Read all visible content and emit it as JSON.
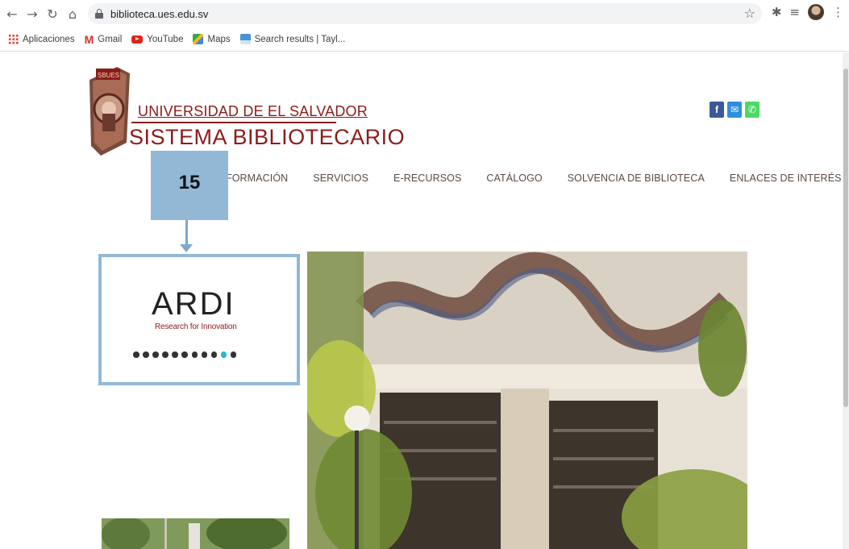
{
  "browser": {
    "url": "biblioteca.ues.edu.sv",
    "bookmarks": [
      "Aplicaciones",
      "Gmail",
      "YouTube",
      "Maps",
      "Search results | Tayl..."
    ]
  },
  "header": {
    "university": "UNIVERSIDAD DE EL SALVADOR",
    "system": "SISTEMA BIBLIOTECARIO",
    "logo_text": "SBUES",
    "social": {
      "facebook": "f",
      "mail": "✉",
      "phone": "✆"
    }
  },
  "menu": {
    "items": [
      "FORMACIÓN",
      "SERVICIOS",
      "E-RECURSOS",
      "CATÁLOGO",
      "SOLVENCIA DE BIBLIOTECA",
      "ENLACES DE INTERÉS"
    ]
  },
  "callout": {
    "number": "15",
    "color": "#92b8d6"
  },
  "carousel": {
    "title": "ARDI",
    "subtitle": "Research for Innovation",
    "dot_count": 11,
    "active_index": 9
  },
  "colors": {
    "brand": "#8b1c1c",
    "active_dot": "#29b6c9"
  }
}
